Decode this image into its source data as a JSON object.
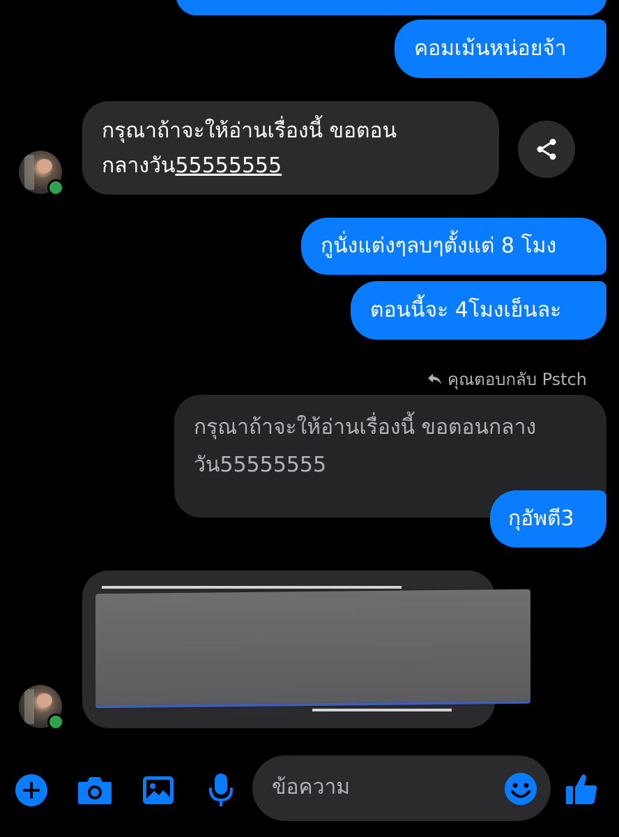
{
  "messages": {
    "out_top_partial": "",
    "out_1": "คอมเม้นหน่อยจ้า",
    "in_1_line1": "กรุณาถ้าจะให้อ่านเรื่องนี้ ขอตอน",
    "in_1_line2_prefix": "กลางวัน",
    "in_1_line2_link": "55555555",
    "out_2": "กูนั่งแต่งๆลบๆตั้งแต่ 8 โมง",
    "out_3": "ตอนนี้จะ 4โมงเย็นละ",
    "reply_label": "คุณตอบกลับ Pstch",
    "quoted_line1": "กรุณาถ้าจะให้อ่านเรื่องนี้ ขอตอนกลาง",
    "quoted_line2": "วัน55555555",
    "out_4": "กุอัพตี3"
  },
  "composer": {
    "placeholder": "ข้อความ"
  },
  "icons": {
    "share": "share-icon",
    "add": "plus-circle-icon",
    "camera": "camera-icon",
    "gallery": "image-icon",
    "mic": "microphone-icon",
    "emoji": "emoji-icon",
    "like": "thumbs-up-icon",
    "reply": "reply-arrow-icon"
  },
  "colors": {
    "accent": "#0a7cff",
    "incoming_bubble": "#2b2b2d",
    "background": "#000000",
    "online": "#31a24c"
  }
}
